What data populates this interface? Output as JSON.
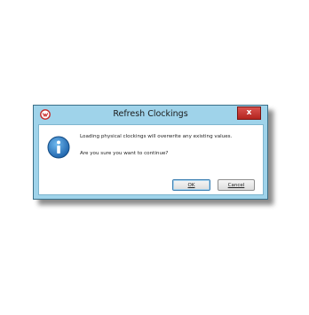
{
  "dialog": {
    "title": "Refresh Clockings",
    "close_label": "x",
    "message_line_1": "Loading physical clockings will overwrite any existing values.",
    "message_line_2": "Are you sure you want to continue?",
    "ok_label": "OK",
    "cancel_label": "Cancel"
  },
  "icons": {
    "app": "app-logo-icon",
    "info": "info-icon",
    "close": "close-icon"
  },
  "colors": {
    "frame": "#9fd3ea",
    "close_button": "#c9302c",
    "info_icon": "#1f6fb5"
  }
}
